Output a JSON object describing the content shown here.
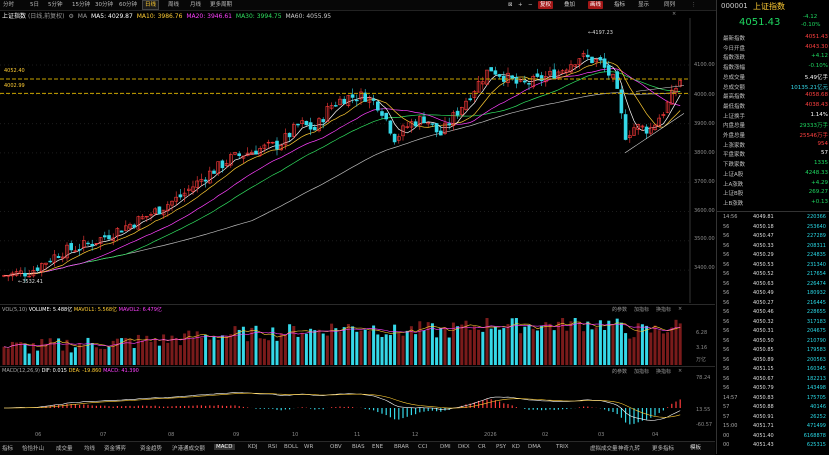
{
  "timeframes": [
    "分时",
    "5日",
    "5分钟",
    "15分钟",
    "30分钟",
    "60分钟",
    "日线",
    "周线",
    "月线",
    "更多周期"
  ],
  "active_timeframe": "日线",
  "top_right_buttons": [
    "复权",
    "叠加",
    "画线",
    "指标",
    "显示",
    "同列"
  ],
  "chart": {
    "title": "上证指数",
    "mode": "(日线,前复权)",
    "ma_legend": {
      "name": "MA",
      "ma5": "MA5: 4029.87",
      "ma10": "MA10: 3986.76",
      "ma20": "MA20: 3946.61",
      "ma30": "MA30: 3994.75",
      "ma60": "MA60: 4055.95"
    },
    "high_label": "4197.23",
    "low_label": "3532.41",
    "ref_line_1": "4052.40",
    "ref_line_2": "4002.99",
    "y_ticks": [
      "4100.00",
      "4000.00",
      "3900.00",
      "3800.00",
      "3700.00",
      "3600.00",
      "3500.00",
      "3400.00"
    ],
    "x_labels": [
      "06",
      "07",
      "08",
      "09",
      "10",
      "11",
      "12",
      "2026",
      "02",
      "03",
      "04"
    ]
  },
  "volume_pane": {
    "name": "VOL(5,10)",
    "volume": "VOLUME: 5.488亿",
    "ma1": "MAVOL1: 5.568亿",
    "ma2": "MAVOL2: 6.479亿",
    "ticks": [
      "6.28",
      "3.16",
      "万亿"
    ],
    "tools": [
      "的参数",
      "加指标",
      "换指标"
    ]
  },
  "macd_pane": {
    "name": "MACD(12,26,9)",
    "dif": "DIF: 0.015",
    "dea": "DEA: -19.860",
    "macd": "MACD: 41.390",
    "ticks": [
      "78.24",
      "13.55",
      "-60.57"
    ],
    "tools": [
      "的参数",
      "加指标",
      "换指标"
    ]
  },
  "bottom_tabs": [
    "指标",
    "恰恰扑山",
    "成交量",
    "均线",
    "资金博弈",
    "资金趋势",
    "沪港通成交额",
    "MACD",
    "KDJ",
    "RSI",
    "BOLL",
    "WR",
    "OBV",
    "BIAS",
    "ENE",
    "BRAR",
    "CCI",
    "DMI",
    "DKX",
    "CR",
    "PSY",
    "KD",
    "DMA",
    "TRIX",
    "虚拟成交量",
    "神奇九转",
    "更多指标"
  ],
  "active_bottom_tab": "MACD",
  "bottom_right": "模板",
  "quote": {
    "code": "000001",
    "name": "上证指数",
    "price": "4051.43",
    "change": "-4.12",
    "change_pct": "-0.10%",
    "rows": [
      {
        "k": "最新指数",
        "v": "4051.43",
        "c": "red"
      },
      {
        "k": "今日开盘",
        "v": "4043.30",
        "c": "red"
      },
      {
        "k": "指数涨跌",
        "v": "+4.12",
        "c": "green"
      },
      {
        "k": "指数涨幅",
        "v": "-0.10%",
        "c": "green"
      },
      {
        "k": "总成交量",
        "v": "5.49亿手",
        "c": "white"
      },
      {
        "k": "总成交额",
        "v": "10135.21亿元",
        "c": "cyan"
      },
      {
        "k": "最高指数",
        "v": "4058.68",
        "c": "red"
      },
      {
        "k": "最低指数",
        "v": "4038.43",
        "c": "red"
      },
      {
        "k": "上证换手",
        "v": "1.14%",
        "c": "white"
      },
      {
        "k": "内盘总量",
        "v": "29333万手",
        "c": "green"
      },
      {
        "k": "外盘总量",
        "v": "25546万手",
        "c": "red"
      },
      {
        "k": "上涨家数",
        "v": "954",
        "c": "red"
      },
      {
        "k": "平盘家数",
        "v": "57",
        "c": "white"
      },
      {
        "k": "下跌家数",
        "v": "1335",
        "c": "green"
      },
      {
        "k": "上证A股",
        "v": "4248.33",
        "c": "green"
      },
      {
        "k": "上A涨跌",
        "v": "+4.29",
        "c": "green"
      },
      {
        "k": "上证B股",
        "v": "269.27",
        "c": "green"
      },
      {
        "k": "上B涨跌",
        "v": "+0.13",
        "c": "green"
      }
    ]
  },
  "ticks": [
    {
      "t": "14:56",
      "p": "4049.81",
      "v": "220366"
    },
    {
      "t": "56",
      "p": "4050.18",
      "v": "253640"
    },
    {
      "t": "56",
      "p": "4050.47",
      "v": "227289"
    },
    {
      "t": "56",
      "p": "4050.33",
      "v": "208311"
    },
    {
      "t": "56",
      "p": "4050.29",
      "v": "224835"
    },
    {
      "t": "56",
      "p": "4050.53",
      "v": "231340"
    },
    {
      "t": "56",
      "p": "4050.52",
      "v": "217654"
    },
    {
      "t": "56",
      "p": "4050.63",
      "v": "226474"
    },
    {
      "t": "56",
      "p": "4050.49",
      "v": "180932"
    },
    {
      "t": "56",
      "p": "4050.27",
      "v": "216445"
    },
    {
      "t": "56",
      "p": "4050.46",
      "v": "228655"
    },
    {
      "t": "56",
      "p": "4050.32",
      "v": "317183"
    },
    {
      "t": "56",
      "p": "4050.31",
      "v": "204675"
    },
    {
      "t": "56",
      "p": "4050.50",
      "v": "210790"
    },
    {
      "t": "56",
      "p": "4050.85",
      "v": "179583"
    },
    {
      "t": "56",
      "p": "4050.89",
      "v": "200563"
    },
    {
      "t": "56",
      "p": "4051.15",
      "v": "160345"
    },
    {
      "t": "56",
      "p": "4050.67",
      "v": "182213"
    },
    {
      "t": "56",
      "p": "4050.79",
      "v": "143498"
    },
    {
      "t": "14:57",
      "p": "4050.83",
      "v": "175705"
    },
    {
      "t": "57",
      "p": "4050.88",
      "v": "40146"
    },
    {
      "t": "57",
      "p": "4050.91",
      "v": "26252"
    },
    {
      "t": "15:00",
      "p": "4051.71",
      "v": "471499"
    },
    {
      "t": "00",
      "p": "4051.40",
      "v": "6168878"
    },
    {
      "t": "00",
      "p": "4051.43",
      "v": "625315"
    }
  ]
}
